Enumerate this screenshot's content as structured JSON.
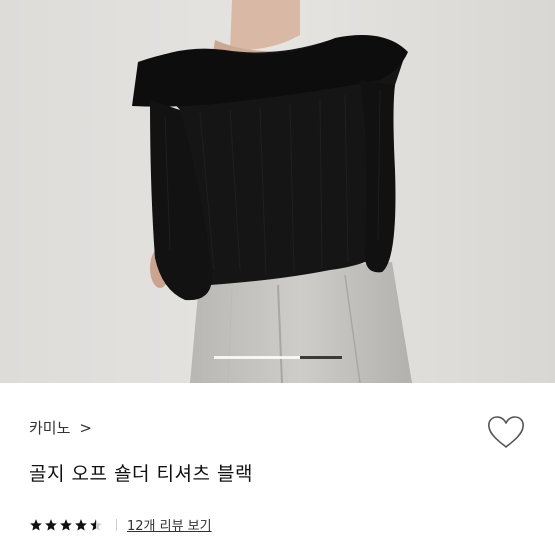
{
  "product": {
    "brand": "카미노",
    "brand_chevron": ">",
    "title": "골지 오프 숄더 티셔츠 블랙",
    "rating": 4.5,
    "rating_max": 5,
    "review_link": "12개 리뷰 보기"
  },
  "gallery": {
    "current_image": 2,
    "total_images": 3
  },
  "colors": {
    "star": "#111111",
    "heart_stroke": "#555555",
    "pager_active": "#3a3a3a"
  }
}
